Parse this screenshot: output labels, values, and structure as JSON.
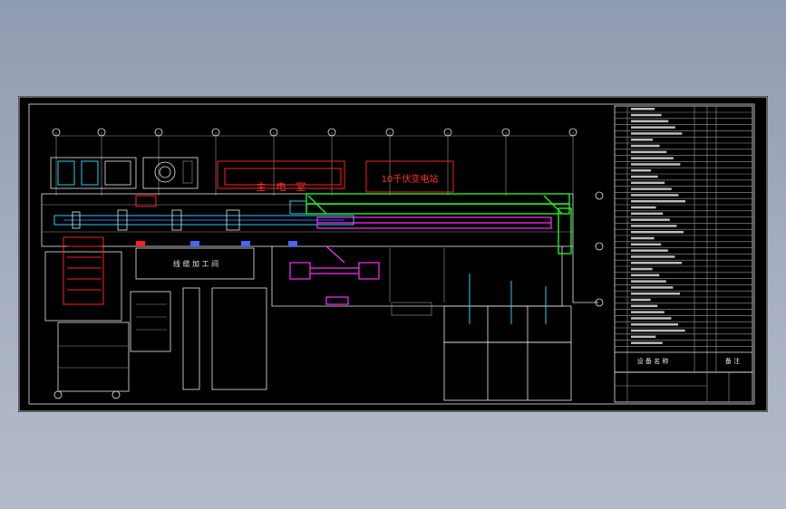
{
  "drawing": {
    "label_main_room": "主　电　室",
    "label_pv_station": "10千伏变电站",
    "label_wire_workshop": "线 缆 加 工 间"
  },
  "table": {
    "footer_name_header": "设 备 名 称",
    "footer_remark_header": "备 注"
  },
  "colors": {
    "sheet_bg": "#000000",
    "window_bg": "#9aa5b8",
    "red": "#ff2020",
    "green": "#22ee22",
    "magenta": "#ff30ff",
    "cyan": "#25d0f0",
    "blue": "#4466ff"
  }
}
